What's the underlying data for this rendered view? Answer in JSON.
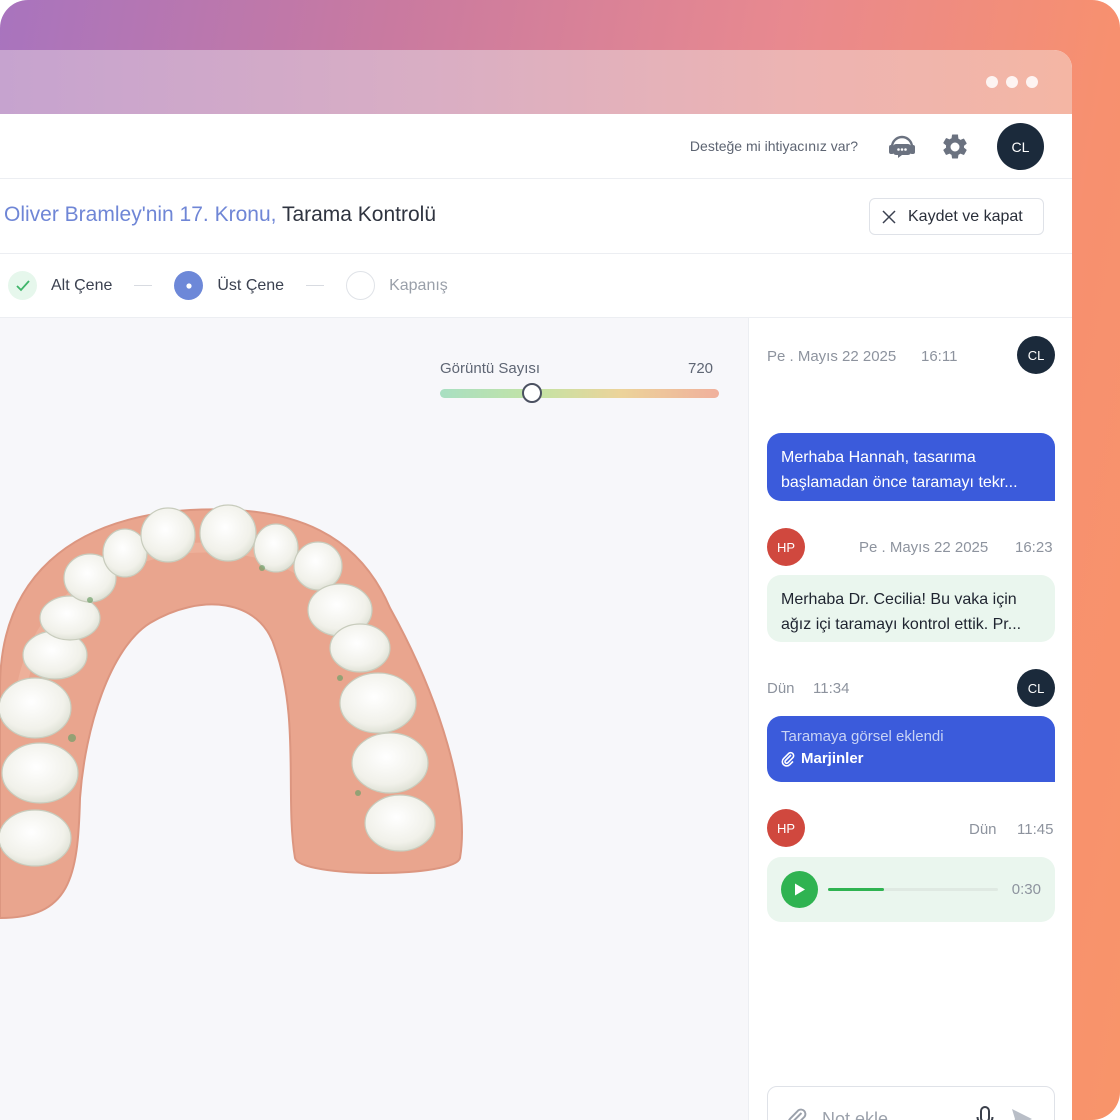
{
  "header": {
    "help_text": "Desteğe mi ihtiyacınız var?",
    "user_initials": "CL"
  },
  "case": {
    "patient_title": "Oliver Bramley'nin 17. Kronu,",
    "task_title": "Tarama Kontrolü",
    "close_label": "Kaydet ve kapat"
  },
  "steps": [
    {
      "label": "Alt Çene",
      "state": "done"
    },
    {
      "label": "Üst Çene",
      "state": "active"
    },
    {
      "label": "Kapanış",
      "state": "pending"
    }
  ],
  "viewer": {
    "slider_label": "Görüntü Sayısı",
    "slider_value": "720",
    "slider_position": 0.33
  },
  "chat": {
    "messages": [
      {
        "author": "CL",
        "date": "Pe . Mayıs 22 2025",
        "time": "16:11",
        "text": "Merhaba Hannah, tasarıma başlamadan önce taramayı tekr..."
      },
      {
        "author": "HP",
        "date": "Pe . Mayıs 22 2025",
        "time": "16:23",
        "text": "Merhaba Dr. Cecilia! Bu vaka için ağız içi taramayı kontrol ettik. Pr..."
      },
      {
        "author": "CL",
        "date": "Dün",
        "time": "11:34",
        "attachment_note": "Taramaya görsel eklendi",
        "attachment_name": "Marjinler"
      },
      {
        "author": "HP",
        "date": "Dün",
        "time": "11:45",
        "audio_duration": "0:30",
        "audio_progress": 0.33
      }
    ],
    "composer_placeholder": "Not ekle"
  },
  "colors": {
    "accent_blue": "#3b5bdb",
    "patient_blue": "#6f86d6",
    "success_green": "#2fb351",
    "avatar_dark": "#1b2a3b",
    "avatar_red": "#d0483e"
  }
}
